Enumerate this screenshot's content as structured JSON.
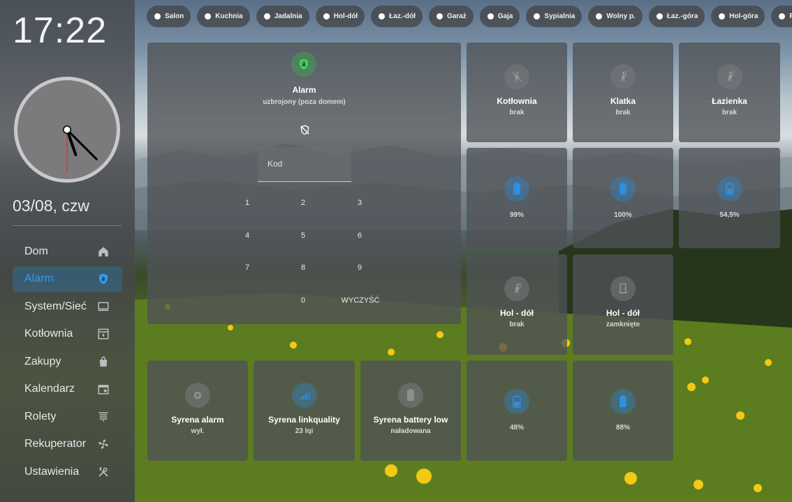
{
  "clock": {
    "time": "17:22",
    "date": "03/08, czw",
    "hour": 17,
    "minute": 22,
    "second": 30
  },
  "nav": [
    {
      "label": "Dom",
      "icon": "home-icon",
      "active": false
    },
    {
      "label": "Alarm",
      "icon": "shield-icon",
      "active": true
    },
    {
      "label": "System/Sieć",
      "icon": "computer-icon",
      "active": false
    },
    {
      "label": "Kotłownia",
      "icon": "boiler-icon",
      "active": false
    },
    {
      "label": "Zakupy",
      "icon": "shopping-bag-icon",
      "active": false
    },
    {
      "label": "Kalendarz",
      "icon": "calendar-icon",
      "active": false
    },
    {
      "label": "Rolety",
      "icon": "blinds-icon",
      "active": false
    },
    {
      "label": "Rekuperator",
      "icon": "fan-icon",
      "active": false
    },
    {
      "label": "Ustawienia",
      "icon": "tools-icon",
      "active": false
    }
  ],
  "chips": [
    "Salon",
    "Kuchnia",
    "Jadalnia",
    "Hol-dół",
    "Łaz.-dół",
    "Garaż",
    "Gaja",
    "Sypialnia",
    "Wolny p.",
    "Łaz.-góra",
    "Hol-góra",
    "Pole"
  ],
  "alarm": {
    "name": "Alarm",
    "state": "uzbrojony (poza domem)",
    "code_placeholder": "Kod",
    "keys": [
      "1",
      "2",
      "3",
      "4",
      "5",
      "6",
      "7",
      "8",
      "9",
      "0"
    ],
    "clear_label": "WYCZYŚĆ"
  },
  "sensors": [
    {
      "name": "Kotłownia",
      "state": "brak",
      "icon": "motion-off-icon"
    },
    {
      "name": "Klatka",
      "state": "brak",
      "icon": "walk-icon"
    },
    {
      "name": "Łazienka",
      "state": "brak",
      "icon": "walk-icon"
    }
  ],
  "batteries_row1": [
    "99%",
    "100%",
    "54,5%"
  ],
  "hol": [
    {
      "name": "Hol - dół",
      "state": "brak",
      "icon": "walk-icon"
    },
    {
      "name": "Hol - dół",
      "state": "zamknięte",
      "icon": "door-closed-icon"
    }
  ],
  "siren": [
    {
      "name": "Syrena alarm",
      "state": "wył.",
      "icon": "siren-icon",
      "style": "grey"
    },
    {
      "name": "Syrena linkquality",
      "state": "23 lqi",
      "icon": "signal-icon",
      "style": "blue"
    },
    {
      "name": "Syrena battery low",
      "state": "naładowana",
      "icon": "battery-grey-icon",
      "style": "grey"
    }
  ],
  "batteries_row2": [
    "48%",
    "88%"
  ],
  "colors": {
    "accent": "#2e9bf0",
    "alarm_green": "#3cb34a",
    "battery_blue": "#2f8fe0"
  }
}
